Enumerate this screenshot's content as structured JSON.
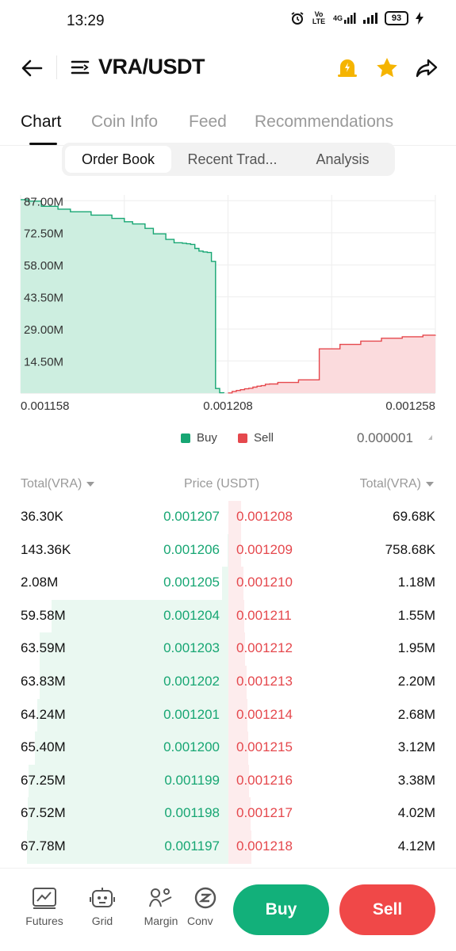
{
  "status_bar": {
    "time": "13:29",
    "network": "Vo LTE",
    "signal_label": "4G",
    "battery": "93"
  },
  "header": {
    "pair": "VRA/USDT"
  },
  "tabs": [
    {
      "label": "Chart",
      "active": true
    },
    {
      "label": "Coin Info",
      "active": false
    },
    {
      "label": "Feed",
      "active": false
    },
    {
      "label": "Recommendations",
      "active": false
    }
  ],
  "segments": [
    {
      "label": "Order Book",
      "active": true
    },
    {
      "label": "Recent Trad...",
      "active": false
    },
    {
      "label": "Analysis",
      "active": false
    }
  ],
  "chart_data": {
    "type": "area",
    "title": "",
    "xlabel": "",
    "ylabel": "",
    "x_ticks": [
      "0.001158",
      "0.001208",
      "0.001258"
    ],
    "y_ticks": [
      "87.00M",
      "72.50M",
      "58.00M",
      "43.50M",
      "29.00M",
      "14.50M"
    ],
    "xlim": [
      0.001158,
      0.001258
    ],
    "ylim": [
      0,
      87000000
    ],
    "grid": true,
    "legend": "bottom-center",
    "series": [
      {
        "name": "Buy",
        "color": "#17a673",
        "fill": "#cdeee0",
        "x": [
          0.001158,
          0.00116,
          0.001163,
          0.001167,
          0.00117,
          0.001175,
          0.00118,
          0.001183,
          0.001185,
          0.001188,
          0.00119,
          0.001193,
          0.001195,
          0.001197,
          0.001198,
          0.001199,
          0.0012,
          0.001201,
          0.001202,
          0.001203,
          0.001204,
          0.001205,
          0.001206,
          0.001207
        ],
        "values": [
          87500000,
          86800000,
          84500000,
          83200000,
          82000000,
          80500000,
          79000000,
          77500000,
          76500000,
          74500000,
          72000000,
          69500000,
          68000000,
          67780000,
          67520000,
          67250000,
          65400000,
          64240000,
          63830000,
          63590000,
          59580000,
          2080000,
          143360,
          36300
        ]
      },
      {
        "name": "Sell",
        "color": "#e5484d",
        "fill": "#fbdbdd",
        "x": [
          0.001208,
          0.001209,
          0.00121,
          0.001211,
          0.001212,
          0.001213,
          0.001214,
          0.001215,
          0.001216,
          0.001217,
          0.001218,
          0.00122,
          0.001225,
          0.00123,
          0.001235,
          0.00124,
          0.001245,
          0.00125,
          0.001255,
          0.001258
        ],
        "values": [
          69680,
          758680,
          1180000,
          1550000,
          1950000,
          2200000,
          2680000,
          3120000,
          3380000,
          4020000,
          4120000,
          4800000,
          6000000,
          20000000,
          22000000,
          23500000,
          24800000,
          25500000,
          26200000,
          26300000
        ]
      }
    ]
  },
  "legend": {
    "buy_label": "Buy",
    "sell_label": "Sell",
    "buy_color": "#17a673",
    "sell_color": "#e5484d",
    "precision": "0.000001"
  },
  "orderbook": {
    "header_left": "Total(VRA)",
    "header_mid": "Price (USDT)",
    "header_right": "Total(VRA)",
    "max_total": 70000000,
    "rows": [
      {
        "bid_total": "36.30K",
        "bid_price": "0.001207",
        "ask_price": "0.001208",
        "ask_total": "69.68K",
        "bid_depth": 0.0,
        "ask_depth": 0.0
      },
      {
        "bid_total": "143.36K",
        "bid_price": "0.001206",
        "ask_price": "0.001209",
        "ask_total": "758.68K",
        "bid_depth": 0.002,
        "ask_depth": 0.0
      },
      {
        "bid_total": "2.08M",
        "bid_price": "0.001205",
        "ask_price": "0.001210",
        "ask_total": "1.18M",
        "bid_depth": 0.03,
        "ask_depth": 0.01
      },
      {
        "bid_total": "59.58M",
        "bid_price": "0.001204",
        "ask_price": "0.001211",
        "ask_total": "1.55M",
        "bid_depth": 0.85,
        "ask_depth": 0.015
      },
      {
        "bid_total": "63.59M",
        "bid_price": "0.001203",
        "ask_price": "0.001212",
        "ask_total": "1.95M",
        "bid_depth": 0.91,
        "ask_depth": 0.02
      },
      {
        "bid_total": "63.83M",
        "bid_price": "0.001202",
        "ask_price": "0.001213",
        "ask_total": "2.20M",
        "bid_depth": 0.91,
        "ask_depth": 0.025
      },
      {
        "bid_total": "64.24M",
        "bid_price": "0.001201",
        "ask_price": "0.001214",
        "ask_total": "2.68M",
        "bid_depth": 0.92,
        "ask_depth": 0.03
      },
      {
        "bid_total": "65.40M",
        "bid_price": "0.001200",
        "ask_price": "0.001215",
        "ask_total": "3.12M",
        "bid_depth": 0.93,
        "ask_depth": 0.035
      },
      {
        "bid_total": "67.25M",
        "bid_price": "0.001199",
        "ask_price": "0.001216",
        "ask_total": "3.38M",
        "bid_depth": 0.96,
        "ask_depth": 0.04
      },
      {
        "bid_total": "67.52M",
        "bid_price": "0.001198",
        "ask_price": "0.001217",
        "ask_total": "4.02M",
        "bid_depth": 0.965,
        "ask_depth": 0.045
      },
      {
        "bid_total": "67.78M",
        "bid_price": "0.001197",
        "ask_price": "0.001218",
        "ask_total": "4.12M",
        "bid_depth": 0.97,
        "ask_depth": 0.05
      }
    ]
  },
  "bottom_nav": [
    {
      "label": "Futures",
      "icon": "futures-icon"
    },
    {
      "label": "Grid",
      "icon": "grid-bot-icon"
    },
    {
      "label": "Margin",
      "icon": "margin-icon"
    },
    {
      "label": "Conv",
      "icon": "convert-icon"
    }
  ],
  "actions": {
    "buy_label": "Buy",
    "sell_label": "Sell",
    "buy_color": "#12b07a",
    "sell_color": "#f04848"
  }
}
